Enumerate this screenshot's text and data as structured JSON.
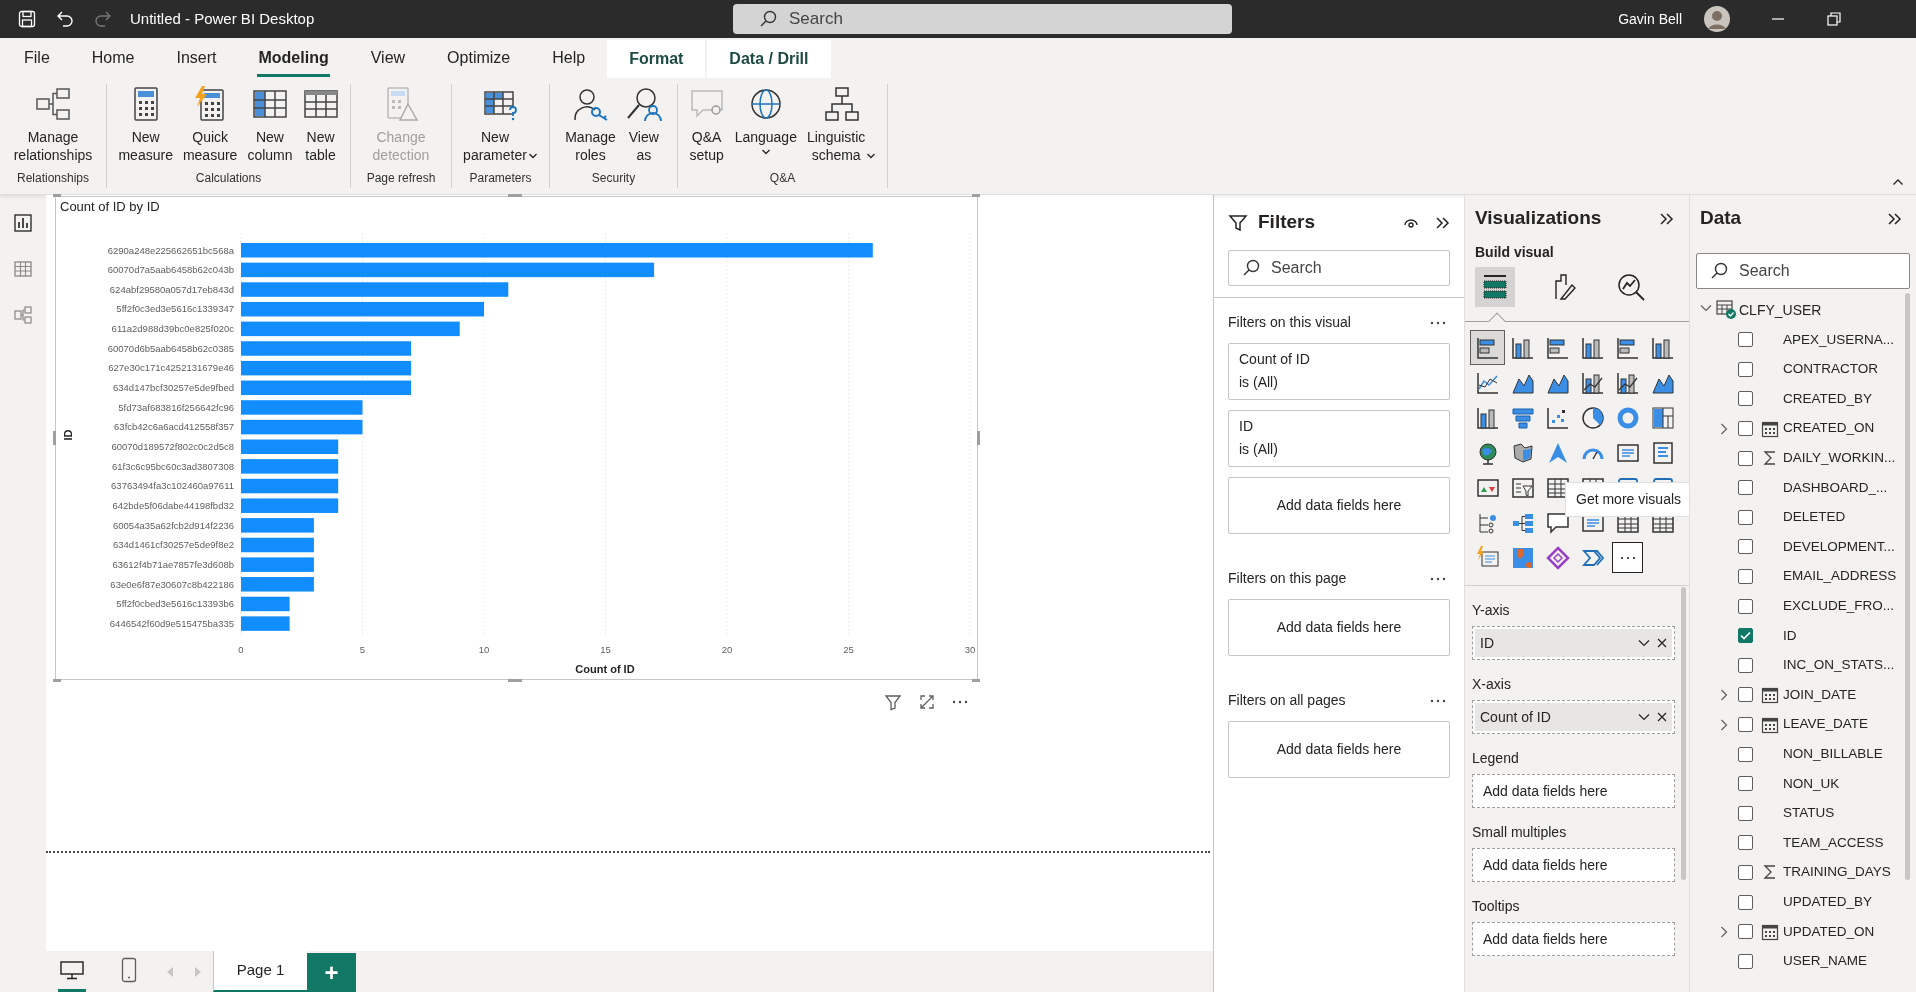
{
  "title_bar": {
    "title": "Untitled - Power BI Desktop",
    "redo_disabled": true,
    "search": {
      "placeholder": "Search"
    },
    "user": "Gavin Bell"
  },
  "tabs": [
    {
      "label": "File",
      "selected": false,
      "kind": "normal"
    },
    {
      "label": "Home",
      "selected": false,
      "kind": "normal"
    },
    {
      "label": "Insert",
      "selected": false,
      "kind": "normal"
    },
    {
      "label": "Modeling",
      "selected": true,
      "kind": "normal"
    },
    {
      "label": "View",
      "selected": false,
      "kind": "normal"
    },
    {
      "label": "Optimize",
      "selected": false,
      "kind": "normal"
    },
    {
      "label": "Help",
      "selected": false,
      "kind": "normal"
    },
    {
      "label": "Format",
      "selected": false,
      "kind": "contextual"
    },
    {
      "label": "Data / Drill",
      "selected": false,
      "kind": "contextual"
    }
  ],
  "ribbon": [
    {
      "label": "Relationships",
      "buttons": [
        {
          "label": "Manage\nrelationships",
          "disabled": false,
          "dropdown": false
        }
      ]
    },
    {
      "label": "Calculations",
      "buttons": [
        {
          "label": "New\nmeasure",
          "disabled": false,
          "dropdown": false
        },
        {
          "label": "Quick\nmeasure",
          "disabled": false,
          "dropdown": false
        },
        {
          "label": "New\ncolumn",
          "disabled": false,
          "dropdown": false
        },
        {
          "label": "New\ntable",
          "disabled": false,
          "dropdown": false
        }
      ]
    },
    {
      "label": "Page refresh",
      "buttons": [
        {
          "label": "Change\ndetection",
          "disabled": true,
          "dropdown": false
        }
      ]
    },
    {
      "label": "Parameters",
      "buttons": [
        {
          "label": "New\nparameter",
          "disabled": false,
          "dropdown": true
        }
      ]
    },
    {
      "label": "Security",
      "buttons": [
        {
          "label": "Manage\nroles",
          "disabled": false,
          "dropdown": false
        },
        {
          "label": "View\nas",
          "disabled": false,
          "dropdown": false
        }
      ]
    },
    {
      "label": "Q&A",
      "buttons": [
        {
          "label": "Q&A\nsetup",
          "disabled": false,
          "dropdown": false
        },
        {
          "label": "Language",
          "disabled": false,
          "dropdown": true
        },
        {
          "label": "Linguistic\nschema",
          "disabled": false,
          "dropdown": true
        }
      ]
    }
  ],
  "nav": [
    {
      "selected": true
    },
    {
      "selected": false
    },
    {
      "selected": false
    }
  ],
  "visual": {
    "selected": true,
    "chart_data": {
      "type": "bar",
      "orientation": "horizontal",
      "title": "Count of ID by ID",
      "xlabel": "Count of ID",
      "ylabel": "ID",
      "categories": [
        "6290a248e225662651bc568a",
        "60070d7a5aab6458b62c043b",
        "624abf29580a057d17eb843d",
        "5ff2f0c3ed3e5616c1339347",
        "611a2d988d39bc0e825f020c",
        "60070d6b5aab6458b62c0385",
        "627e30c171c4252131679e46",
        "634d147bcf30257e5de9fbed",
        "5fd73af683816f256642fc96",
        "63fcb42c6a6acd412558f357",
        "60070d189572f802c0c2d5c8",
        "61f3c6c95bc60c3ad3807308",
        "63763494fa3c102460a97611",
        "642bde5f06dabe44198fbd32",
        "60054a35a62fcb2d914f2236",
        "634d1461cf30257e5de9f8e2",
        "63612f4b71ae7857fe3d608b",
        "63e0e6f87e30607c8b422186",
        "5ff2f0cbed3e5616c13393b6",
        "6446542f60d9e515475ba335"
      ],
      "values": [
        26,
        17,
        11,
        10,
        9,
        7,
        7,
        7,
        5,
        5,
        4,
        4,
        4,
        4,
        3,
        3,
        3,
        3,
        2,
        2
      ],
      "xlim": [
        0,
        30
      ],
      "grid": true,
      "xticks": [
        0,
        5,
        10,
        15,
        20,
        25,
        30
      ]
    }
  },
  "filters": {
    "title": "Filters",
    "search": {
      "placeholder": "Search"
    },
    "sections": [
      {
        "title": "Filters on this visual",
        "cards": [
          {
            "kind": "filter",
            "field": "Count of ID",
            "condition": "is (All)"
          },
          {
            "kind": "filter",
            "field": "ID",
            "condition": "is (All)"
          },
          {
            "kind": "drop",
            "label": "Add data fields here"
          }
        ]
      },
      {
        "title": "Filters on this page",
        "cards": [
          {
            "kind": "drop",
            "label": "Add data fields here"
          }
        ]
      },
      {
        "title": "Filters on all pages",
        "cards": [
          {
            "kind": "drop",
            "label": "Add data fields here"
          }
        ]
      }
    ]
  },
  "visualizations": {
    "title": "Visualizations",
    "subtitle": "Build visual",
    "panes": [
      {
        "selected": true
      },
      {
        "selected": false
      },
      {
        "selected": false
      }
    ],
    "gallery": [
      {
        "selected": true
      },
      {
        "selected": false
      },
      {
        "selected": false
      },
      {
        "selected": false
      },
      {
        "selected": false
      },
      {
        "selected": false
      },
      {
        "selected": false
      },
      {
        "selected": false
      },
      {
        "selected": false
      },
      {
        "selected": false
      },
      {
        "selected": false
      },
      {
        "selected": false
      },
      {
        "selected": false
      },
      {
        "selected": false
      },
      {
        "selected": false
      },
      {
        "selected": false
      },
      {
        "selected": false
      },
      {
        "selected": false
      },
      {
        "selected": false
      },
      {
        "selected": false
      },
      {
        "selected": false
      },
      {
        "selected": false
      },
      {
        "selected": false
      },
      {
        "selected": false
      },
      {
        "selected": false
      },
      {
        "selected": false
      },
      {
        "selected": false
      },
      {
        "selected": false
      },
      {
        "selected": false
      },
      {
        "selected": false
      },
      {
        "selected": false
      },
      {
        "selected": false
      },
      {
        "selected": false
      },
      {
        "selected": false
      },
      {
        "selected": false
      },
      {
        "selected": false
      },
      {
        "selected": false
      },
      {
        "selected": false
      },
      {
        "selected": false
      },
      {
        "selected": false
      }
    ],
    "tooltip": "Get more visuals",
    "wells": [
      {
        "label": "Y-axis",
        "fields": [
          "ID"
        ]
      },
      {
        "label": "X-axis",
        "fields": [
          "Count of ID"
        ]
      },
      {
        "label": "Legend",
        "placeholder": "Add data fields here"
      },
      {
        "label": "Small multiples",
        "placeholder": "Add data fields here"
      },
      {
        "label": "Tooltips",
        "placeholder": "Add data fields here"
      }
    ]
  },
  "data": {
    "title": "Data",
    "search": {
      "placeholder": "Search"
    },
    "tree": [
      {
        "label": "CLFY_USER",
        "expanded": true,
        "children": [
          {
            "label": "APEX_USERNA...",
            "checked": false,
            "kind": "text"
          },
          {
            "label": "CONTRACTOR",
            "checked": false,
            "kind": "text"
          },
          {
            "label": "CREATED_BY",
            "checked": false,
            "kind": "text"
          },
          {
            "label": "CREATED_ON",
            "checked": false,
            "kind": "date",
            "expanded": false
          },
          {
            "label": "DAILY_WORKIN...",
            "checked": false,
            "kind": "sum"
          },
          {
            "label": "DASHBOARD_...",
            "checked": false,
            "kind": "text"
          },
          {
            "label": "DELETED",
            "checked": false,
            "kind": "text"
          },
          {
            "label": "DEVELOPMENT...",
            "checked": false,
            "kind": "text"
          },
          {
            "label": "EMAIL_ADDRESS",
            "checked": false,
            "kind": "text"
          },
          {
            "label": "EXCLUDE_FRO...",
            "checked": false,
            "kind": "text"
          },
          {
            "label": "ID",
            "checked": true,
            "kind": "text"
          },
          {
            "label": "INC_ON_STATS...",
            "checked": false,
            "kind": "text"
          },
          {
            "label": "JOIN_DATE",
            "checked": false,
            "kind": "date",
            "expanded": false
          },
          {
            "label": "LEAVE_DATE",
            "checked": false,
            "kind": "date",
            "expanded": false
          },
          {
            "label": "NON_BILLABLE",
            "checked": false,
            "kind": "text"
          },
          {
            "label": "NON_UK",
            "checked": false,
            "kind": "text"
          },
          {
            "label": "STATUS",
            "checked": false,
            "kind": "text"
          },
          {
            "label": "TEAM_ACCESS",
            "checked": false,
            "kind": "text"
          },
          {
            "label": "TRAINING_DAYS",
            "checked": false,
            "kind": "sum"
          },
          {
            "label": "UPDATED_BY",
            "checked": false,
            "kind": "text"
          },
          {
            "label": "UPDATED_ON",
            "checked": false,
            "kind": "date",
            "expanded": false
          },
          {
            "label": "USER_NAME",
            "checked": false,
            "kind": "text"
          }
        ]
      }
    ]
  },
  "pages": {
    "views": [
      {
        "selected": true
      },
      {
        "selected": false
      }
    ],
    "tabs": [
      {
        "label": "Page 1",
        "selected": true
      }
    ],
    "add": "+"
  }
}
